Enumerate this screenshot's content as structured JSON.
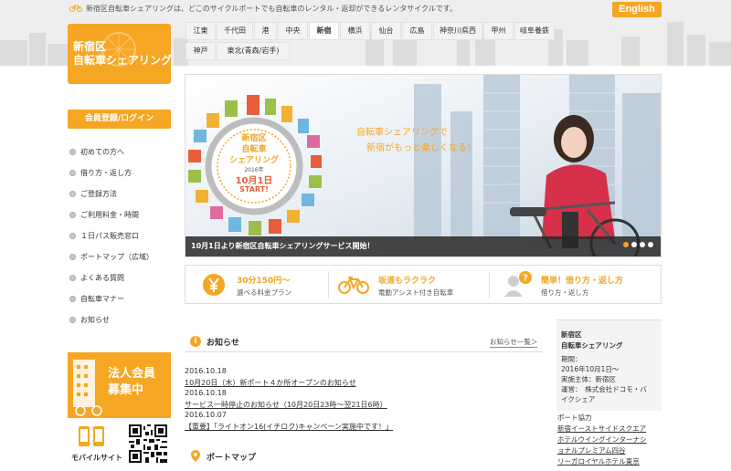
{
  "header": {
    "tagline": "新宿区自転車シェアリングは、どこのサイクルポートでも自転車のレンタル・返却ができるレンタサイクルです。",
    "english_label": "English",
    "logo_line1": "新宿区",
    "logo_line2": "自転車シェアリング"
  },
  "areas": {
    "row1": [
      "江東",
      "千代田",
      "港",
      "中央",
      "新宿",
      "横浜",
      "仙台",
      "広島",
      "神奈川県西",
      "甲州",
      "岐阜養鉄"
    ],
    "row2": [
      "神戸",
      "東北(青森/岩手)"
    ],
    "active": "新宿"
  },
  "sidebar": {
    "member_label": "会員登録/ログイン",
    "items": [
      "初めての方へ",
      "借り方・返し方",
      "ご登録方法",
      "ご利用料金・時間",
      "１日パス販売窓口",
      "ポートマップ（広域）",
      "よくある質問",
      "自転車マナー",
      "お知らせ"
    ],
    "corp_line1": "法人会員",
    "corp_line2": "募集中",
    "mobile_label": "モバイルサイト"
  },
  "hero": {
    "badge_line1": "新宿区",
    "badge_line2": "自転車",
    "badge_line3": "シェアリング",
    "badge_year": "2016年",
    "badge_date": "10月1日",
    "badge_start": "START!",
    "copy_line1": "自転車シェアリングで",
    "copy_line2": "新宿がもっと楽しくなる！",
    "caption": "10月1日より新宿区自転車シェアリングサービス開始！",
    "slide_count": 4,
    "active_slide": 1
  },
  "features": [
    {
      "icon": "yen-icon",
      "title": "30分150円〜",
      "sub": "選べる料金プラン"
    },
    {
      "icon": "bicycle-icon",
      "title": "坂道もラクラク",
      "sub": "電動アシスト付き自転車"
    },
    {
      "icon": "person-question-icon",
      "title": "簡単！借り方・返し方",
      "sub": "借り方・返し方"
    }
  ],
  "news": {
    "title": "お知らせ",
    "more": "お知らせ一覧＞",
    "items": [
      {
        "date": "2016.10.18",
        "text": "10月20日（木）新ポート４か所オープンのお知らせ"
      },
      {
        "date": "2016.10.18",
        "text": "サービス一時停止のお知らせ（10月20日23時〜翌21日6時）"
      },
      {
        "date": "2016.10.07",
        "text": "【重要】「ライトオン16(イチロク)キャンペーン実施中です！」"
      }
    ]
  },
  "portmap": {
    "title": "ポートマップ"
  },
  "info": {
    "name1": "新宿区",
    "name2": "自転車シェアリング",
    "period_label": "期間：",
    "period": "2016年10月1日〜",
    "organizer": "実施主体：新宿区",
    "operator1": "運営：　株式会社ドコモ・バ",
    "operator2": "イクシェア",
    "partner_label": "ポート協力",
    "partners": [
      "新宿イーストサイドスクエア",
      "ホテルウイングインターナシ",
      "ョナルプレミアム四谷",
      "リーガロイヤルホテル東京"
    ]
  },
  "colors": {
    "accent": "#f5a623"
  }
}
